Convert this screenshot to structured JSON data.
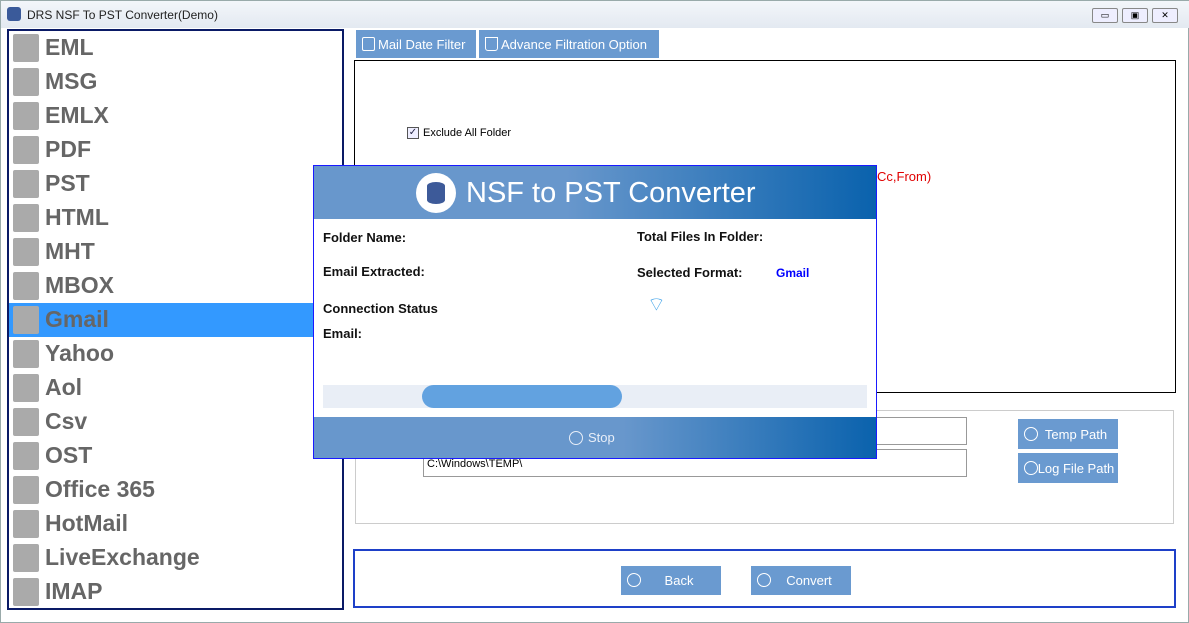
{
  "window": {
    "title": "DRS NSF To PST Converter(Demo)",
    "min": "▭",
    "max": "▣",
    "close": "✕"
  },
  "sidebar": {
    "selected": "Gmail",
    "items": [
      {
        "label": "EML",
        "icon": "eml-file-icon"
      },
      {
        "label": "MSG",
        "icon": "envelope-icon"
      },
      {
        "label": "EMLX",
        "icon": "emlx-file-icon"
      },
      {
        "label": "PDF",
        "icon": "pdf-file-icon"
      },
      {
        "label": "PST",
        "icon": "pst-file-icon"
      },
      {
        "label": "HTML",
        "icon": "html-file-icon"
      },
      {
        "label": "MHT",
        "icon": "mht-file-icon"
      },
      {
        "label": "MBOX",
        "icon": "mbox-icon"
      },
      {
        "label": "Gmail",
        "icon": "gmail-icon"
      },
      {
        "label": "Yahoo",
        "icon": "yahoo-icon"
      },
      {
        "label": "Aol",
        "icon": "aol-icon"
      },
      {
        "label": "Csv",
        "icon": "csv-file-icon"
      },
      {
        "label": "OST",
        "icon": "ost-file-icon"
      },
      {
        "label": "Office 365",
        "icon": "office365-icon"
      },
      {
        "label": "HotMail",
        "icon": "hotmail-icon"
      },
      {
        "label": "LiveExchange",
        "icon": "exchange-icon"
      },
      {
        "label": "IMAP",
        "icon": "imap-icon"
      }
    ]
  },
  "tabs": {
    "mail_date_filter": "Mail Date Filter",
    "advance_filtration": "Advance Filtration Option"
  },
  "filter": {
    "exclude_all_folder": "Exclude All Folder",
    "exclude_checked": true,
    "partial_text": "Cc,From)"
  },
  "paths": {
    "temp_path_value": "",
    "log_path_value": "C:\\Windows\\TEMP\\",
    "temp_path_button": "Temp Path",
    "log_file_path_button": "Log File Path"
  },
  "actions": {
    "back": "Back",
    "convert": "Convert"
  },
  "modal": {
    "title": "NSF to PST Converter",
    "folder_name": "Folder Name:",
    "total_files": "Total Files In Folder:",
    "email_extracted": "Email Extracted:",
    "selected_format": "Selected Format:",
    "selected_format_value": "Gmail",
    "connection_status": "Connection Status",
    "email": "Email:",
    "stop": "Stop",
    "progress_indeterminate": true
  },
  "colors": {
    "accent": "#6a9ad0",
    "selected": "#3399ff",
    "format_value": "#0000ff",
    "warning_text": "#e00000"
  }
}
